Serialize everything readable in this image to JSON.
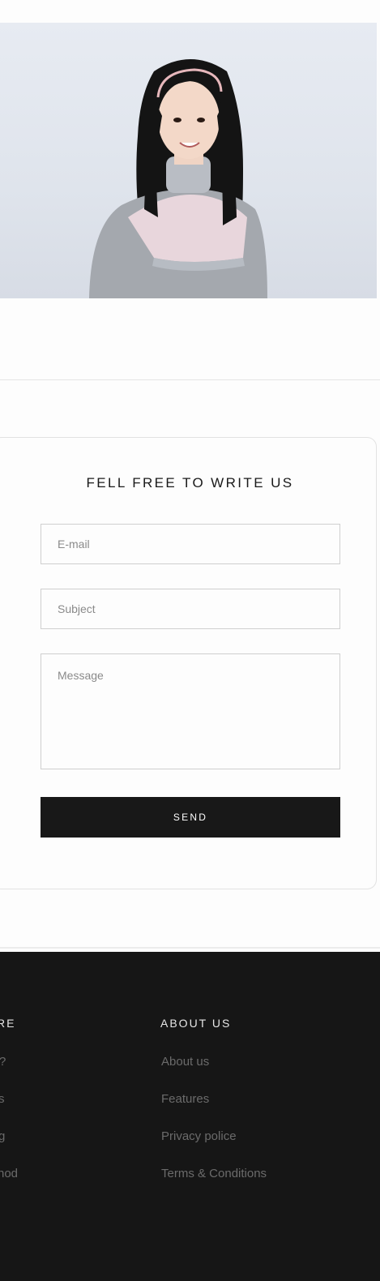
{
  "contact": {
    "title": "FELL FREE TO WRITE US",
    "email_placeholder": "E-mail",
    "subject_placeholder": "Subject",
    "message_placeholder": "Message",
    "send_label": "SEND"
  },
  "footer": {
    "left_column": {
      "title_partial": "RE",
      "items": [
        "?",
        "s",
        "g",
        "hod"
      ]
    },
    "about": {
      "title": "ABOUT US",
      "items": [
        "About us",
        "Features",
        "Privacy police",
        "Terms & Conditions"
      ]
    }
  }
}
